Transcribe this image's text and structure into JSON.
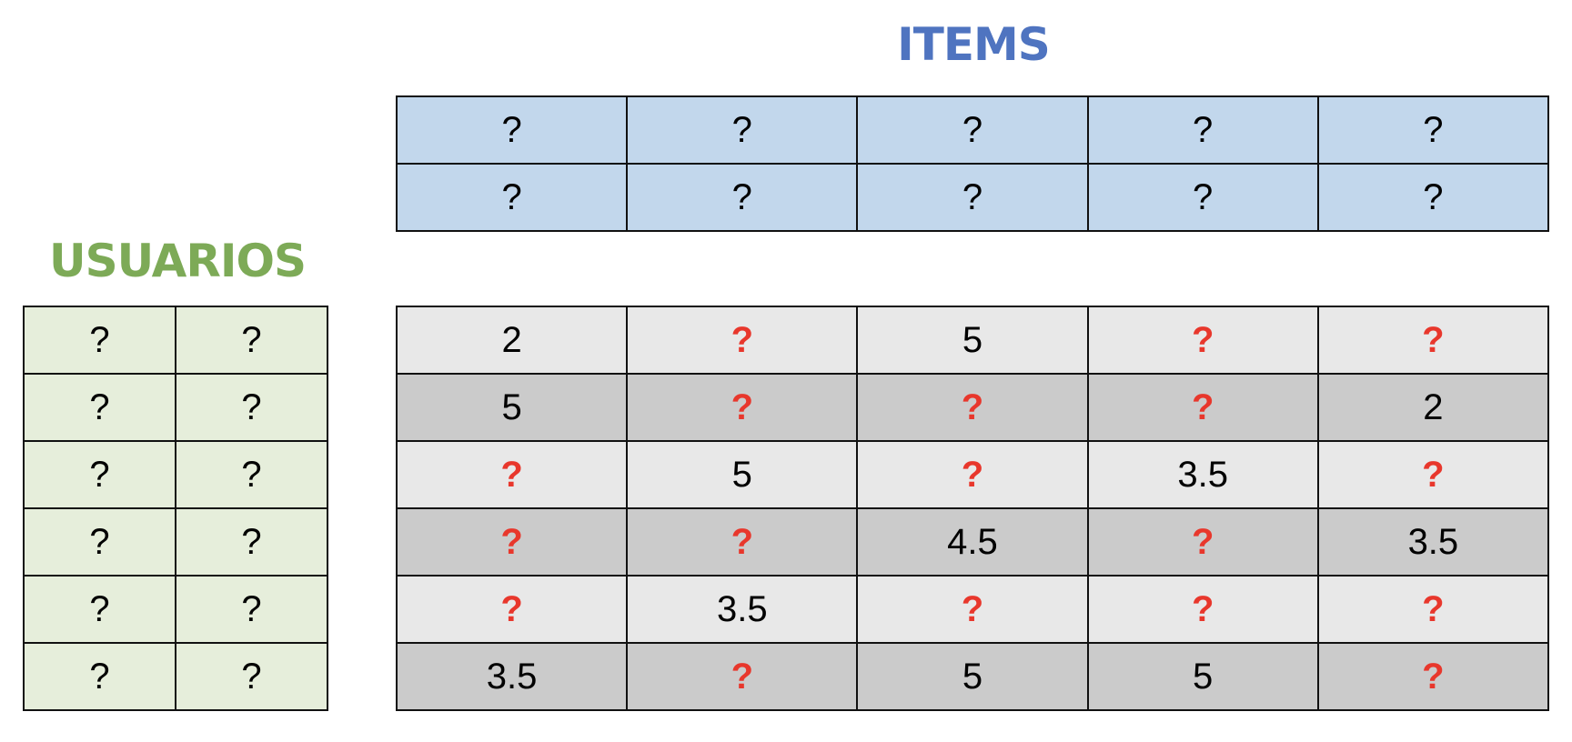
{
  "items_title": "ITEMS",
  "users_title": "USUARIOS",
  "colors": {
    "items_title": "#4f74c0",
    "users_title": "#7daa57",
    "items_fill": "#c2d7ec",
    "users_fill": "#e6eedb",
    "missing": "#e8372c"
  },
  "items_matrix": [
    [
      "?",
      "?",
      "?",
      "?",
      "?"
    ],
    [
      "?",
      "?",
      "?",
      "?",
      "?"
    ]
  ],
  "users_matrix": [
    [
      "?",
      "?"
    ],
    [
      "?",
      "?"
    ],
    [
      "?",
      "?"
    ],
    [
      "?",
      "?"
    ],
    [
      "?",
      "?"
    ],
    [
      "?",
      "?"
    ]
  ],
  "ratings_matrix": [
    [
      "2",
      "?",
      "5",
      "?",
      "?"
    ],
    [
      "5",
      "?",
      "?",
      "?",
      "2"
    ],
    [
      "?",
      "5",
      "?",
      "3.5",
      "?"
    ],
    [
      "?",
      "?",
      "4.5",
      "?",
      "3.5"
    ],
    [
      "?",
      "3.5",
      "?",
      "?",
      "?"
    ],
    [
      "3.5",
      "?",
      "5",
      "5",
      "?"
    ]
  ]
}
